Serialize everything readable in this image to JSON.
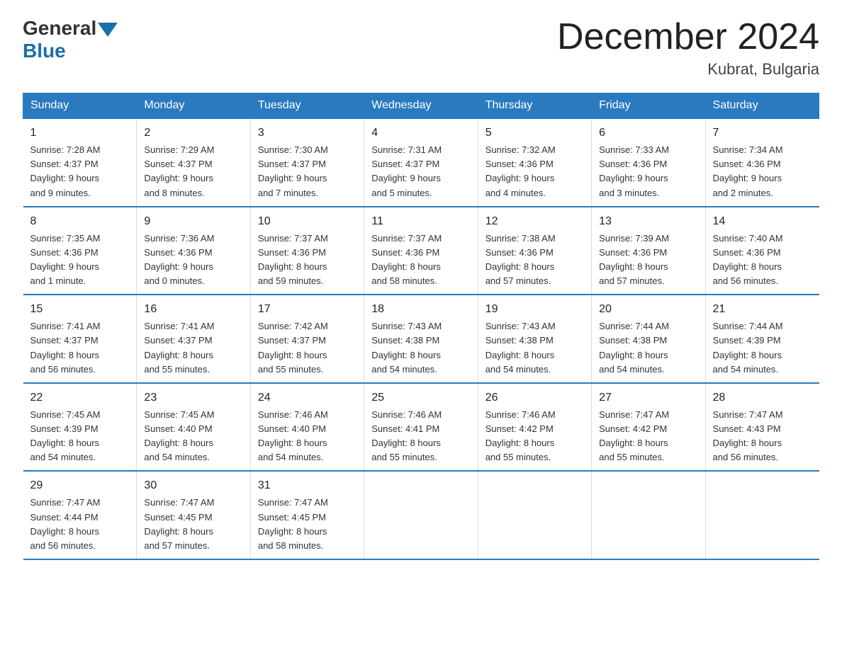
{
  "logo": {
    "general": "General",
    "blue": "Blue"
  },
  "title": "December 2024",
  "location": "Kubrat, Bulgaria",
  "headers": [
    "Sunday",
    "Monday",
    "Tuesday",
    "Wednesday",
    "Thursday",
    "Friday",
    "Saturday"
  ],
  "weeks": [
    [
      {
        "day": "1",
        "sunrise": "Sunrise: 7:28 AM",
        "sunset": "Sunset: 4:37 PM",
        "daylight": "Daylight: 9 hours",
        "daylight2": "and 9 minutes."
      },
      {
        "day": "2",
        "sunrise": "Sunrise: 7:29 AM",
        "sunset": "Sunset: 4:37 PM",
        "daylight": "Daylight: 9 hours",
        "daylight2": "and 8 minutes."
      },
      {
        "day": "3",
        "sunrise": "Sunrise: 7:30 AM",
        "sunset": "Sunset: 4:37 PM",
        "daylight": "Daylight: 9 hours",
        "daylight2": "and 7 minutes."
      },
      {
        "day": "4",
        "sunrise": "Sunrise: 7:31 AM",
        "sunset": "Sunset: 4:37 PM",
        "daylight": "Daylight: 9 hours",
        "daylight2": "and 5 minutes."
      },
      {
        "day": "5",
        "sunrise": "Sunrise: 7:32 AM",
        "sunset": "Sunset: 4:36 PM",
        "daylight": "Daylight: 9 hours",
        "daylight2": "and 4 minutes."
      },
      {
        "day": "6",
        "sunrise": "Sunrise: 7:33 AM",
        "sunset": "Sunset: 4:36 PM",
        "daylight": "Daylight: 9 hours",
        "daylight2": "and 3 minutes."
      },
      {
        "day": "7",
        "sunrise": "Sunrise: 7:34 AM",
        "sunset": "Sunset: 4:36 PM",
        "daylight": "Daylight: 9 hours",
        "daylight2": "and 2 minutes."
      }
    ],
    [
      {
        "day": "8",
        "sunrise": "Sunrise: 7:35 AM",
        "sunset": "Sunset: 4:36 PM",
        "daylight": "Daylight: 9 hours",
        "daylight2": "and 1 minute."
      },
      {
        "day": "9",
        "sunrise": "Sunrise: 7:36 AM",
        "sunset": "Sunset: 4:36 PM",
        "daylight": "Daylight: 9 hours",
        "daylight2": "and 0 minutes."
      },
      {
        "day": "10",
        "sunrise": "Sunrise: 7:37 AM",
        "sunset": "Sunset: 4:36 PM",
        "daylight": "Daylight: 8 hours",
        "daylight2": "and 59 minutes."
      },
      {
        "day": "11",
        "sunrise": "Sunrise: 7:37 AM",
        "sunset": "Sunset: 4:36 PM",
        "daylight": "Daylight: 8 hours",
        "daylight2": "and 58 minutes."
      },
      {
        "day": "12",
        "sunrise": "Sunrise: 7:38 AM",
        "sunset": "Sunset: 4:36 PM",
        "daylight": "Daylight: 8 hours",
        "daylight2": "and 57 minutes."
      },
      {
        "day": "13",
        "sunrise": "Sunrise: 7:39 AM",
        "sunset": "Sunset: 4:36 PM",
        "daylight": "Daylight: 8 hours",
        "daylight2": "and 57 minutes."
      },
      {
        "day": "14",
        "sunrise": "Sunrise: 7:40 AM",
        "sunset": "Sunset: 4:36 PM",
        "daylight": "Daylight: 8 hours",
        "daylight2": "and 56 minutes."
      }
    ],
    [
      {
        "day": "15",
        "sunrise": "Sunrise: 7:41 AM",
        "sunset": "Sunset: 4:37 PM",
        "daylight": "Daylight: 8 hours",
        "daylight2": "and 56 minutes."
      },
      {
        "day": "16",
        "sunrise": "Sunrise: 7:41 AM",
        "sunset": "Sunset: 4:37 PM",
        "daylight": "Daylight: 8 hours",
        "daylight2": "and 55 minutes."
      },
      {
        "day": "17",
        "sunrise": "Sunrise: 7:42 AM",
        "sunset": "Sunset: 4:37 PM",
        "daylight": "Daylight: 8 hours",
        "daylight2": "and 55 minutes."
      },
      {
        "day": "18",
        "sunrise": "Sunrise: 7:43 AM",
        "sunset": "Sunset: 4:38 PM",
        "daylight": "Daylight: 8 hours",
        "daylight2": "and 54 minutes."
      },
      {
        "day": "19",
        "sunrise": "Sunrise: 7:43 AM",
        "sunset": "Sunset: 4:38 PM",
        "daylight": "Daylight: 8 hours",
        "daylight2": "and 54 minutes."
      },
      {
        "day": "20",
        "sunrise": "Sunrise: 7:44 AM",
        "sunset": "Sunset: 4:38 PM",
        "daylight": "Daylight: 8 hours",
        "daylight2": "and 54 minutes."
      },
      {
        "day": "21",
        "sunrise": "Sunrise: 7:44 AM",
        "sunset": "Sunset: 4:39 PM",
        "daylight": "Daylight: 8 hours",
        "daylight2": "and 54 minutes."
      }
    ],
    [
      {
        "day": "22",
        "sunrise": "Sunrise: 7:45 AM",
        "sunset": "Sunset: 4:39 PM",
        "daylight": "Daylight: 8 hours",
        "daylight2": "and 54 minutes."
      },
      {
        "day": "23",
        "sunrise": "Sunrise: 7:45 AM",
        "sunset": "Sunset: 4:40 PM",
        "daylight": "Daylight: 8 hours",
        "daylight2": "and 54 minutes."
      },
      {
        "day": "24",
        "sunrise": "Sunrise: 7:46 AM",
        "sunset": "Sunset: 4:40 PM",
        "daylight": "Daylight: 8 hours",
        "daylight2": "and 54 minutes."
      },
      {
        "day": "25",
        "sunrise": "Sunrise: 7:46 AM",
        "sunset": "Sunset: 4:41 PM",
        "daylight": "Daylight: 8 hours",
        "daylight2": "and 55 minutes."
      },
      {
        "day": "26",
        "sunrise": "Sunrise: 7:46 AM",
        "sunset": "Sunset: 4:42 PM",
        "daylight": "Daylight: 8 hours",
        "daylight2": "and 55 minutes."
      },
      {
        "day": "27",
        "sunrise": "Sunrise: 7:47 AM",
        "sunset": "Sunset: 4:42 PM",
        "daylight": "Daylight: 8 hours",
        "daylight2": "and 55 minutes."
      },
      {
        "day": "28",
        "sunrise": "Sunrise: 7:47 AM",
        "sunset": "Sunset: 4:43 PM",
        "daylight": "Daylight: 8 hours",
        "daylight2": "and 56 minutes."
      }
    ],
    [
      {
        "day": "29",
        "sunrise": "Sunrise: 7:47 AM",
        "sunset": "Sunset: 4:44 PM",
        "daylight": "Daylight: 8 hours",
        "daylight2": "and 56 minutes."
      },
      {
        "day": "30",
        "sunrise": "Sunrise: 7:47 AM",
        "sunset": "Sunset: 4:45 PM",
        "daylight": "Daylight: 8 hours",
        "daylight2": "and 57 minutes."
      },
      {
        "day": "31",
        "sunrise": "Sunrise: 7:47 AM",
        "sunset": "Sunset: 4:45 PM",
        "daylight": "Daylight: 8 hours",
        "daylight2": "and 58 minutes."
      },
      null,
      null,
      null,
      null
    ]
  ]
}
